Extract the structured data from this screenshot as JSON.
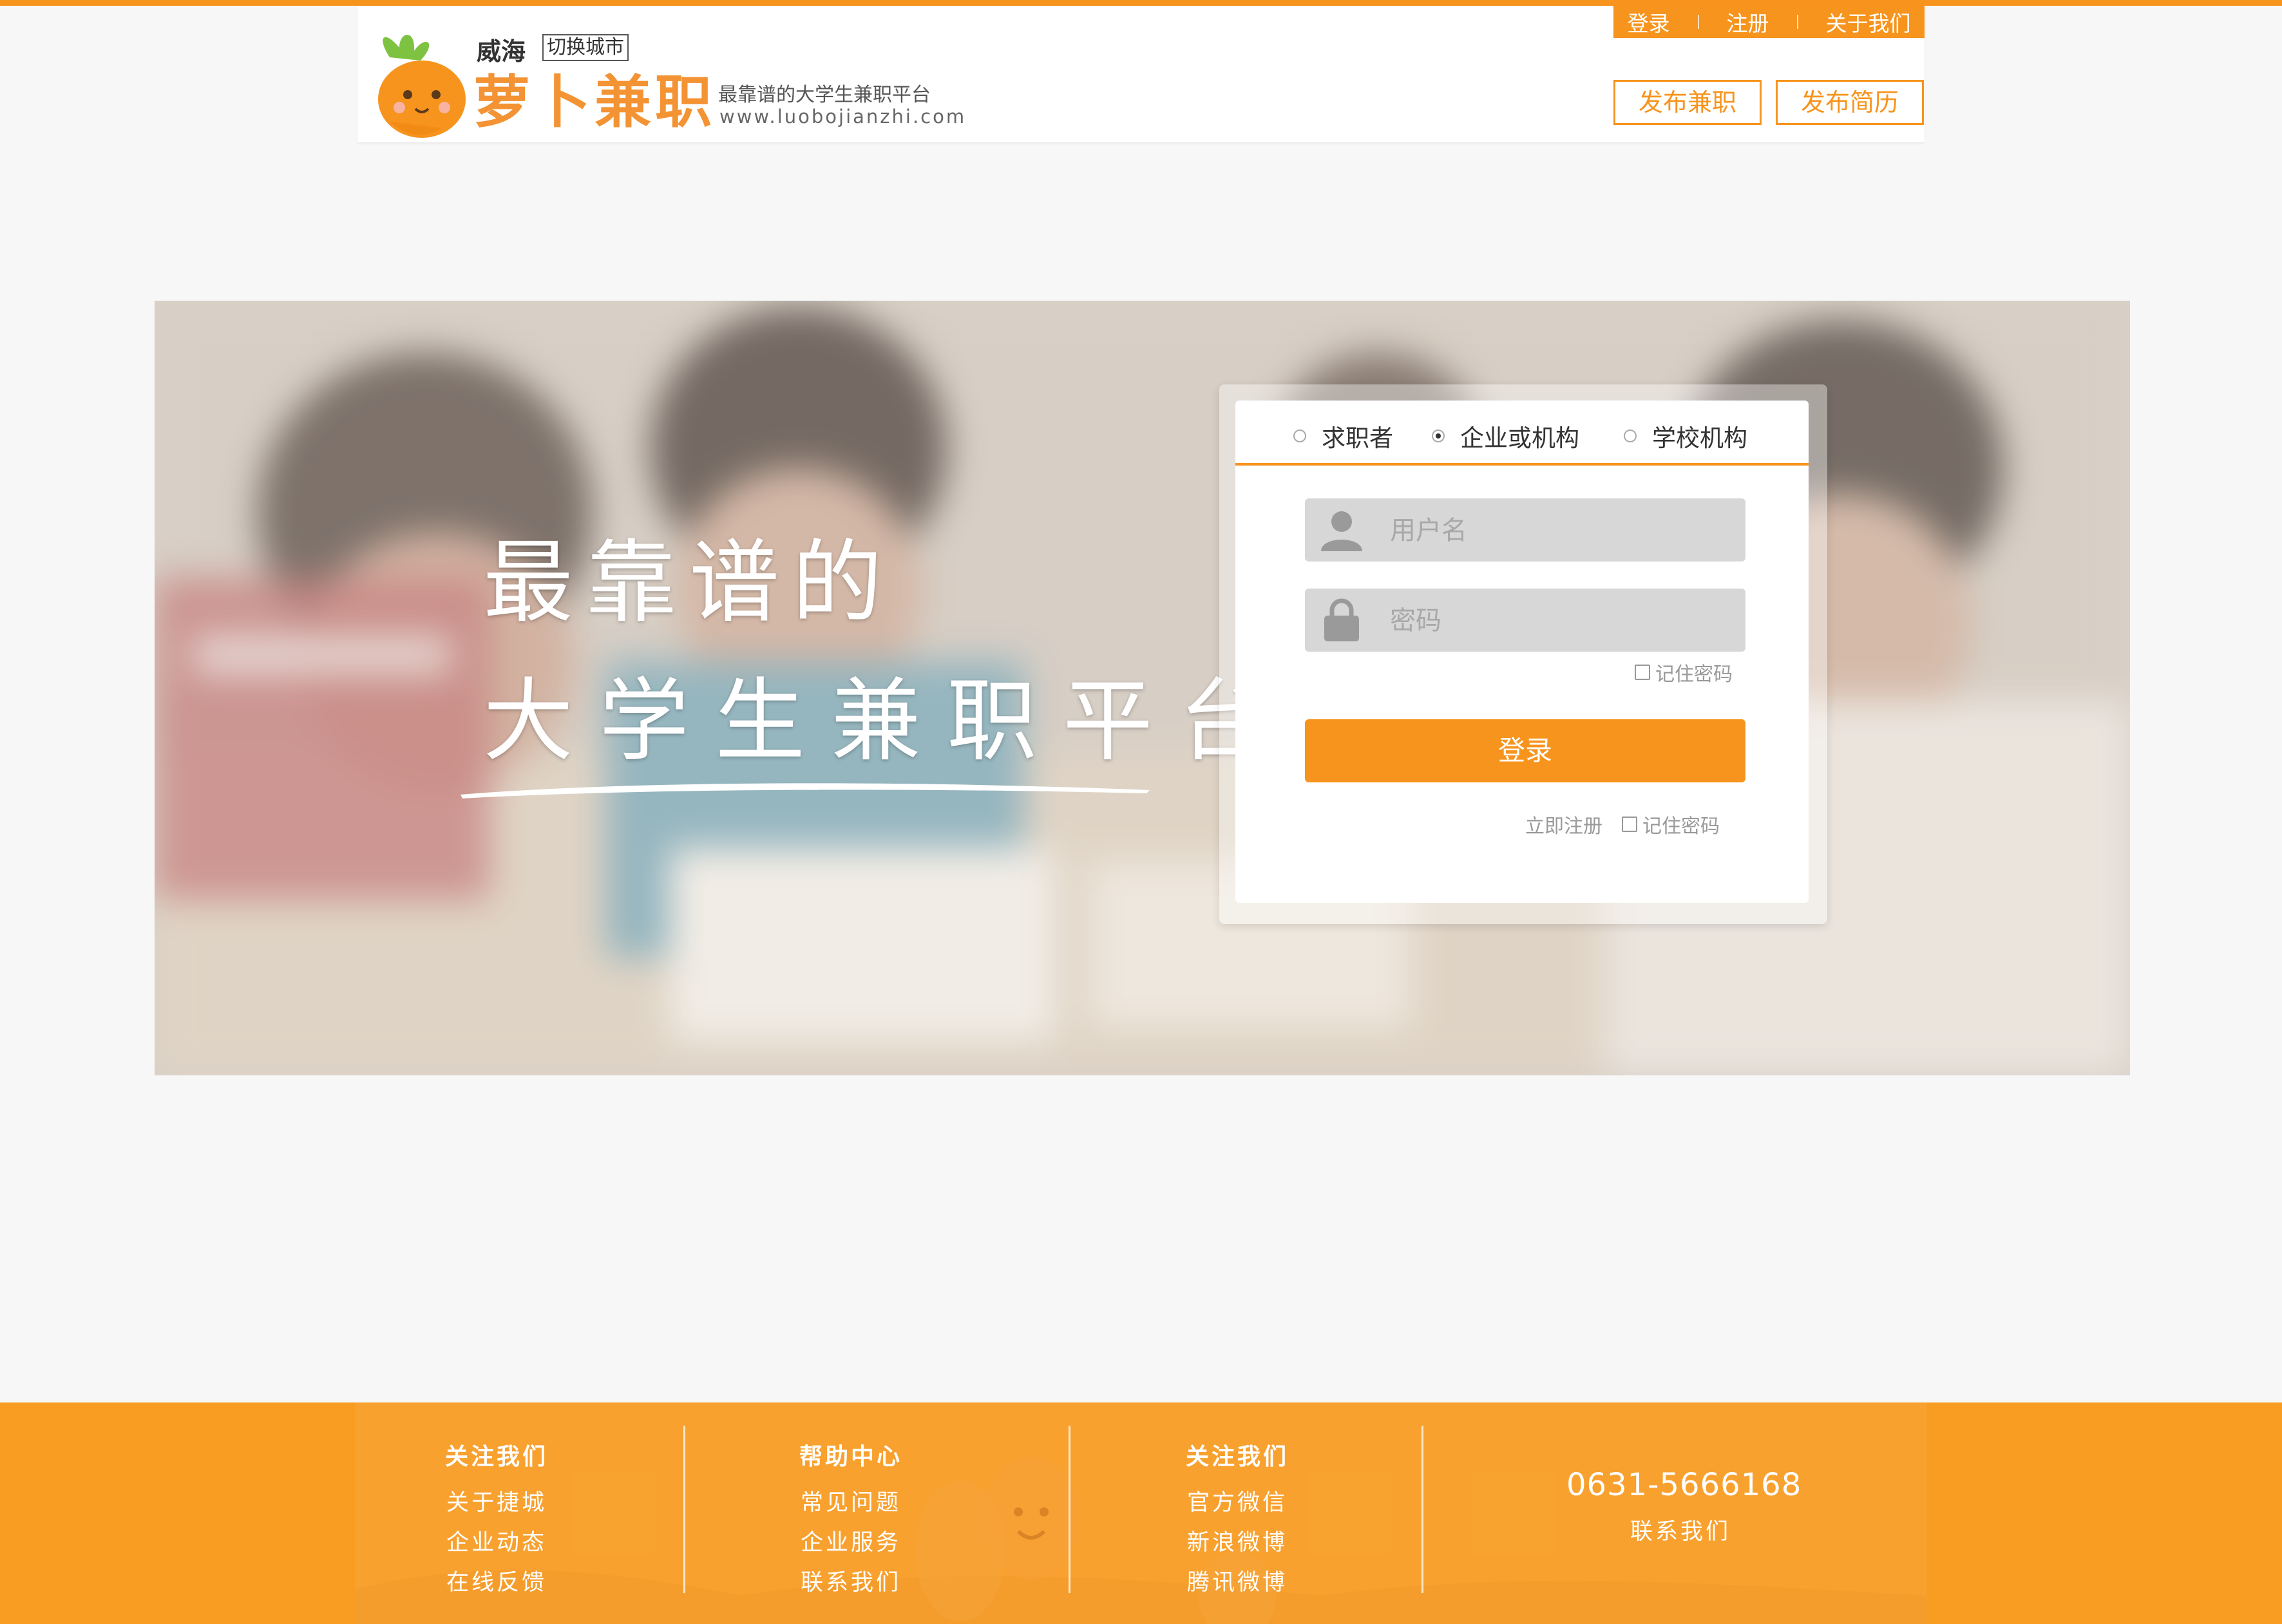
{
  "header": {
    "city": "威海",
    "switch_city": "切换城市",
    "brand_name": "萝卜兼职",
    "slogan": "最靠谱的大学生兼职平台",
    "url": "www.luobojianzhi.com",
    "nav": [
      "登录",
      "注册",
      "关于我们"
    ],
    "post_job": "发布兼职",
    "post_resume": "发布简历"
  },
  "hero": {
    "line1": "最靠谱的",
    "line2": "大学生兼职平台"
  },
  "login": {
    "roles": [
      {
        "label": "求职者",
        "checked": false
      },
      {
        "label": "企业或机构",
        "checked": true
      },
      {
        "label": "学校机构",
        "checked": false
      }
    ],
    "username_placeholder": "用户名",
    "password_placeholder": "密码",
    "remember_top": "记住密码",
    "submit": "登录",
    "register": "立即注册",
    "remember_bottom": "记住密码"
  },
  "footer": {
    "columns": [
      {
        "title": "关注我们",
        "items": [
          "关于捷城",
          "企业动态",
          "在线反馈"
        ]
      },
      {
        "title": "帮助中心",
        "items": [
          "常见问题",
          "企业服务",
          "联系我们"
        ]
      },
      {
        "title": "关注我们",
        "items": [
          "官方微信",
          "新浪微博",
          "腾讯微博"
        ]
      }
    ],
    "phone": "0631-5666168",
    "contact": "联系我们"
  },
  "colors": {
    "accent": "#f7941d",
    "page_bg": "#f7f7f7",
    "field_bg": "#d7d7d7"
  },
  "icons": [
    "carrot-logo-icon",
    "user-icon",
    "lock-icon",
    "radio-icon",
    "checkbox-icon"
  ]
}
